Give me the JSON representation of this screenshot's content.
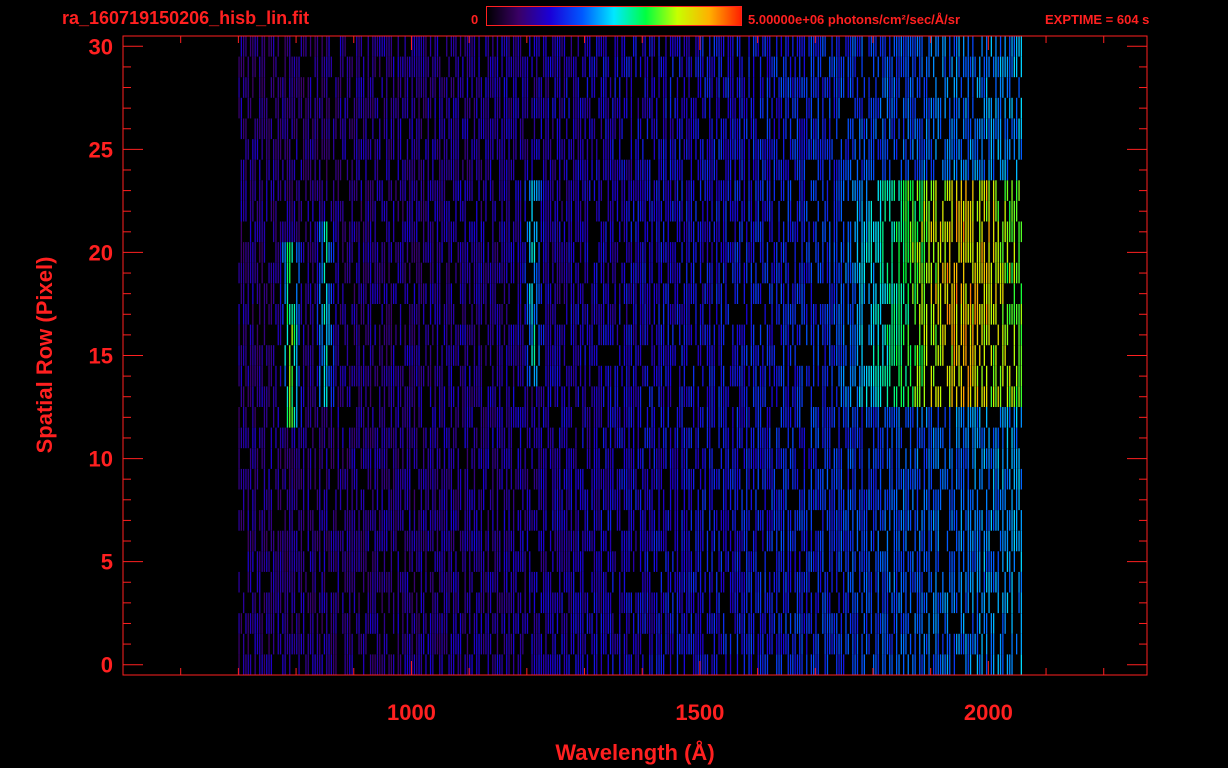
{
  "header": {
    "filename": "ra_160719150206_hisb_lin.fit",
    "colorbar_min_label": "0",
    "colorbar_max_label": "5.00000e+06 photons/cm²/sec/Å/sr",
    "exptime_label": "EXPTIME = 604 s"
  },
  "colorbar": {
    "stops": [
      "#000000",
      "#3a0066",
      "#1a00d8",
      "#0058ff",
      "#00e8ff",
      "#00ff40",
      "#c8ff00",
      "#ffb000",
      "#ff2000"
    ]
  },
  "colors": {
    "axis": "#ff2020",
    "background": "#000000"
  },
  "chart_data": {
    "type": "heatmap",
    "title": "",
    "xlabel": "Wavelength (Å)",
    "ylabel": "Spatial Row (Pixel)",
    "xlim": [
      500,
      2275
    ],
    "ylim": [
      -0.5,
      30.5
    ],
    "x_ticks": [
      1000,
      1500,
      2000
    ],
    "y_ticks": [
      0,
      5,
      10,
      15,
      20,
      25,
      30
    ],
    "rows": [
      0,
      30
    ],
    "detector_range": [
      700,
      2060
    ],
    "features": [
      {
        "name": "",
        "x_center": 790,
        "rows": [
          12,
          20
        ],
        "intensity": 0.62
      },
      {
        "name": "",
        "x_center": 850,
        "rows": [
          13,
          21
        ],
        "intensity": 0.42
      },
      {
        "name": "",
        "x_center": 1210,
        "rows": [
          14,
          23
        ],
        "intensity": 0.35
      },
      {
        "name": "",
        "x_center": 1950,
        "rows": [
          13,
          23
        ],
        "intensity": 0.55
      }
    ]
  }
}
